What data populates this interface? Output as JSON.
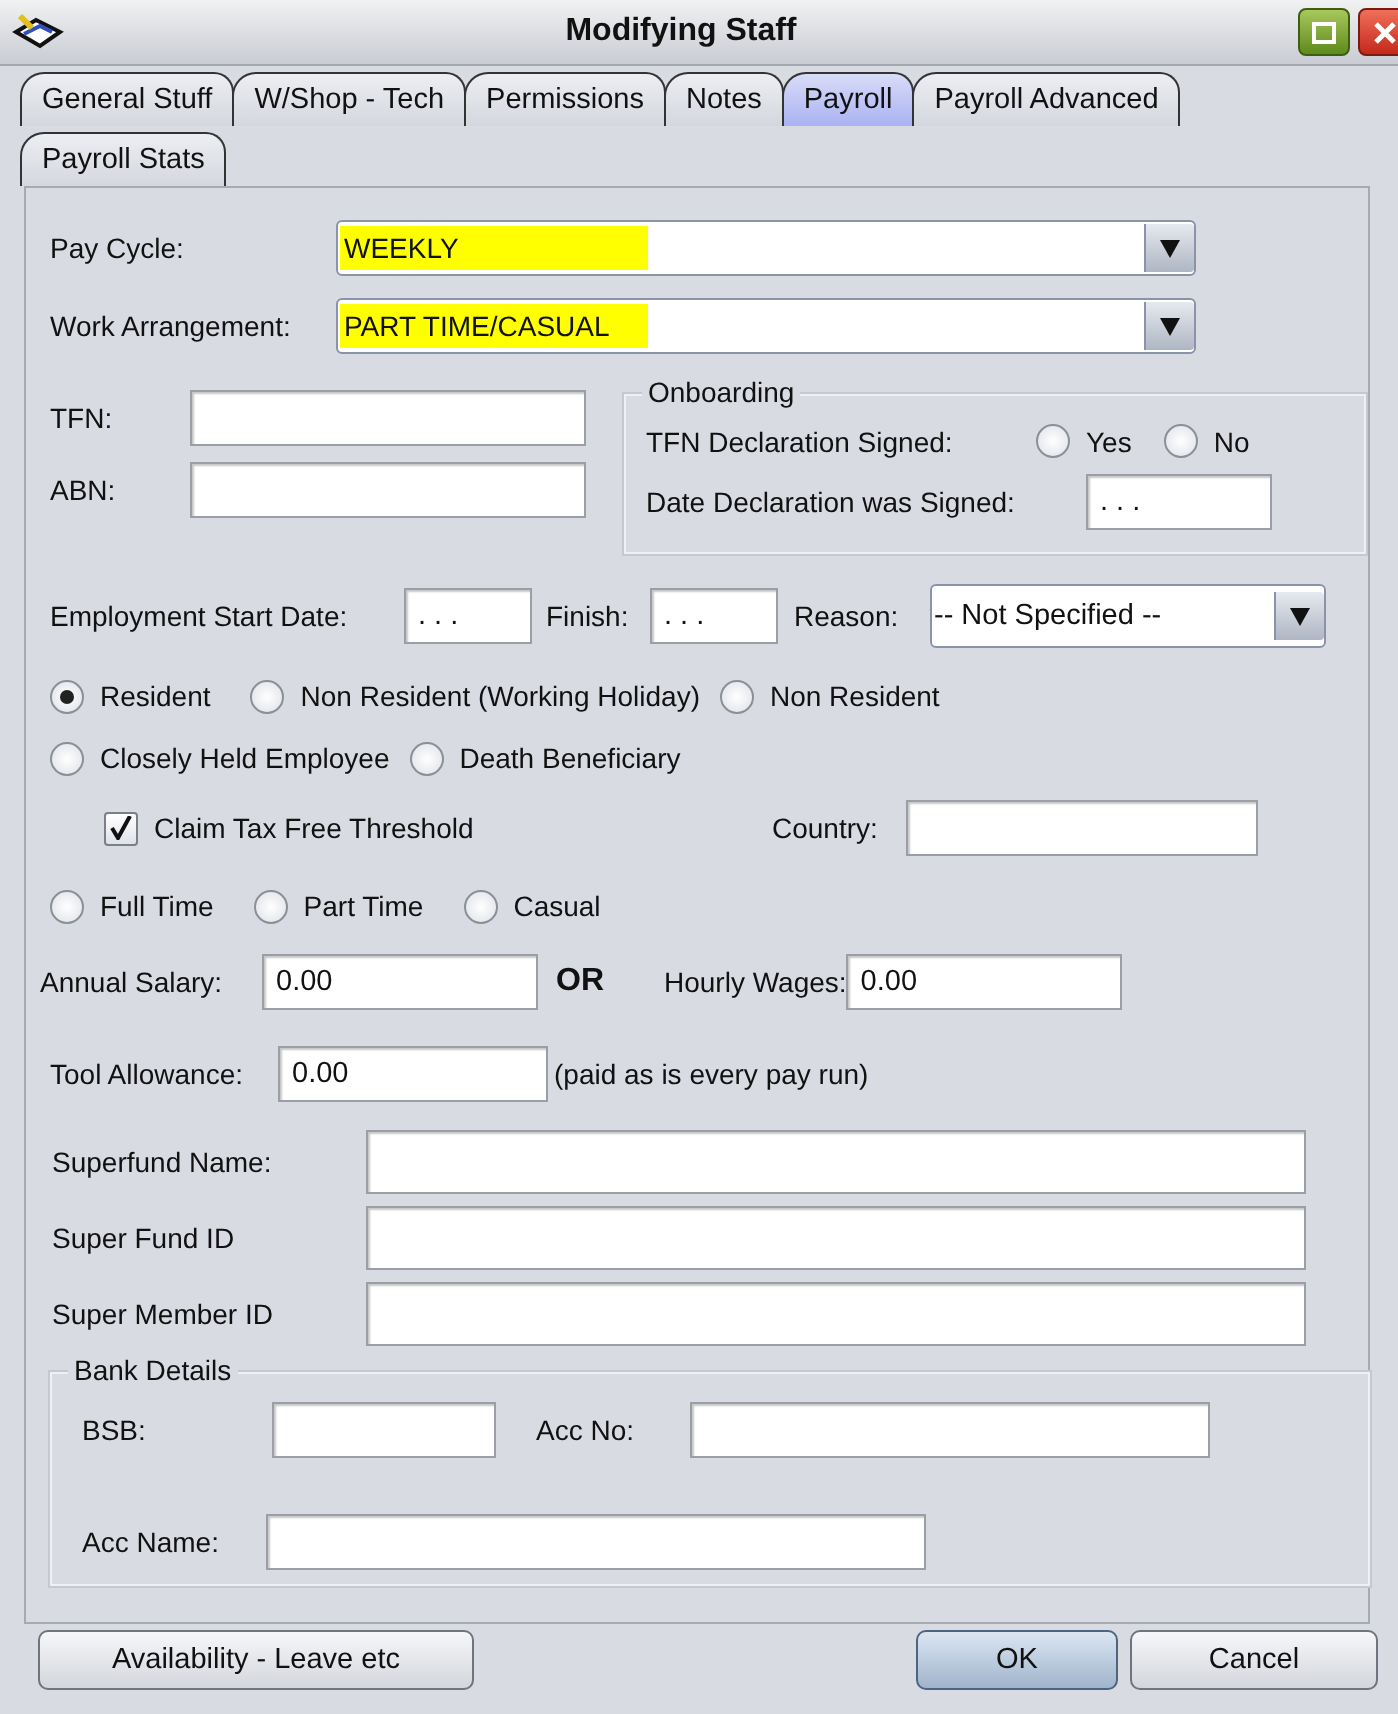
{
  "window": {
    "title": "Modifying Staff"
  },
  "tab_rows": [
    {
      "tabs": [
        {
          "label": "General Stuff",
          "selected": false
        },
        {
          "label": "W/Shop - Tech",
          "selected": false
        },
        {
          "label": "Permissions",
          "selected": false
        },
        {
          "label": "Notes",
          "selected": false
        },
        {
          "label": "Payroll",
          "selected": true
        },
        {
          "label": "Payroll Advanced",
          "selected": false
        }
      ]
    },
    {
      "tabs": [
        {
          "label": "Payroll Stats",
          "selected": false
        }
      ]
    }
  ],
  "pay_cycle": {
    "label": "Pay Cycle:",
    "value": "WEEKLY",
    "highlighted": true
  },
  "work_arrangement": {
    "label": "Work Arrangement:",
    "value": "PART TIME/CASUAL",
    "highlighted": true
  },
  "tfn": {
    "label": "TFN:"
  },
  "abn": {
    "label": "ABN:"
  },
  "onboarding": {
    "title": "Onboarding",
    "declaration_label": "TFN Declaration Signed:",
    "options": [
      {
        "label": "Yes",
        "selected": false
      },
      {
        "label": "No",
        "selected": false
      }
    ],
    "date_label": "Date Declaration was Signed:",
    "date_value": ". . ."
  },
  "employment": {
    "start_label": "Employment Start Date:",
    "start_value": ". . .",
    "finish_label": "Finish:",
    "finish_value": ". . .",
    "reason_label": "Reason:",
    "reason_value": "-- Not Specified --"
  },
  "residency_rows": [
    [
      {
        "label": "Resident",
        "selected": true
      },
      {
        "label": "Non Resident  (Working Holiday)",
        "selected": false
      },
      {
        "label": "Non Resident",
        "selected": false
      }
    ],
    [
      {
        "label": "Closely Held Employee",
        "selected": false
      },
      {
        "label": "Death Beneficiary",
        "selected": false
      }
    ]
  ],
  "tax_free_threshold": {
    "label": "Claim Tax Free Threshold",
    "checked": true
  },
  "country": {
    "label": "Country:"
  },
  "work_type": [
    {
      "label": "Full Time",
      "selected": false
    },
    {
      "label": "Part Time",
      "selected": false
    },
    {
      "label": "Casual",
      "selected": false
    }
  ],
  "annual_salary": {
    "label": "Annual Salary:",
    "value": "0.00"
  },
  "or_label": "OR",
  "hourly_wages": {
    "label": "Hourly Wages:",
    "value": "0.00"
  },
  "tool_allowance": {
    "label": "Tool Allowance:",
    "value": "0.00",
    "note": "(paid as is every pay run)"
  },
  "super_fields": [
    {
      "label": "Superfund Name:"
    },
    {
      "label": "Super Fund ID"
    },
    {
      "label": "Super Member ID"
    }
  ],
  "bank": {
    "title": "Bank Details",
    "bsb_label": "BSB:",
    "acc_no_label": "Acc No:",
    "acc_name_label": "Acc Name:"
  },
  "buttons": [
    {
      "label": "Availability - Leave etc",
      "default": false
    },
    {
      "label": "OK",
      "default": true
    },
    {
      "label": "Cancel",
      "default": false
    }
  ]
}
